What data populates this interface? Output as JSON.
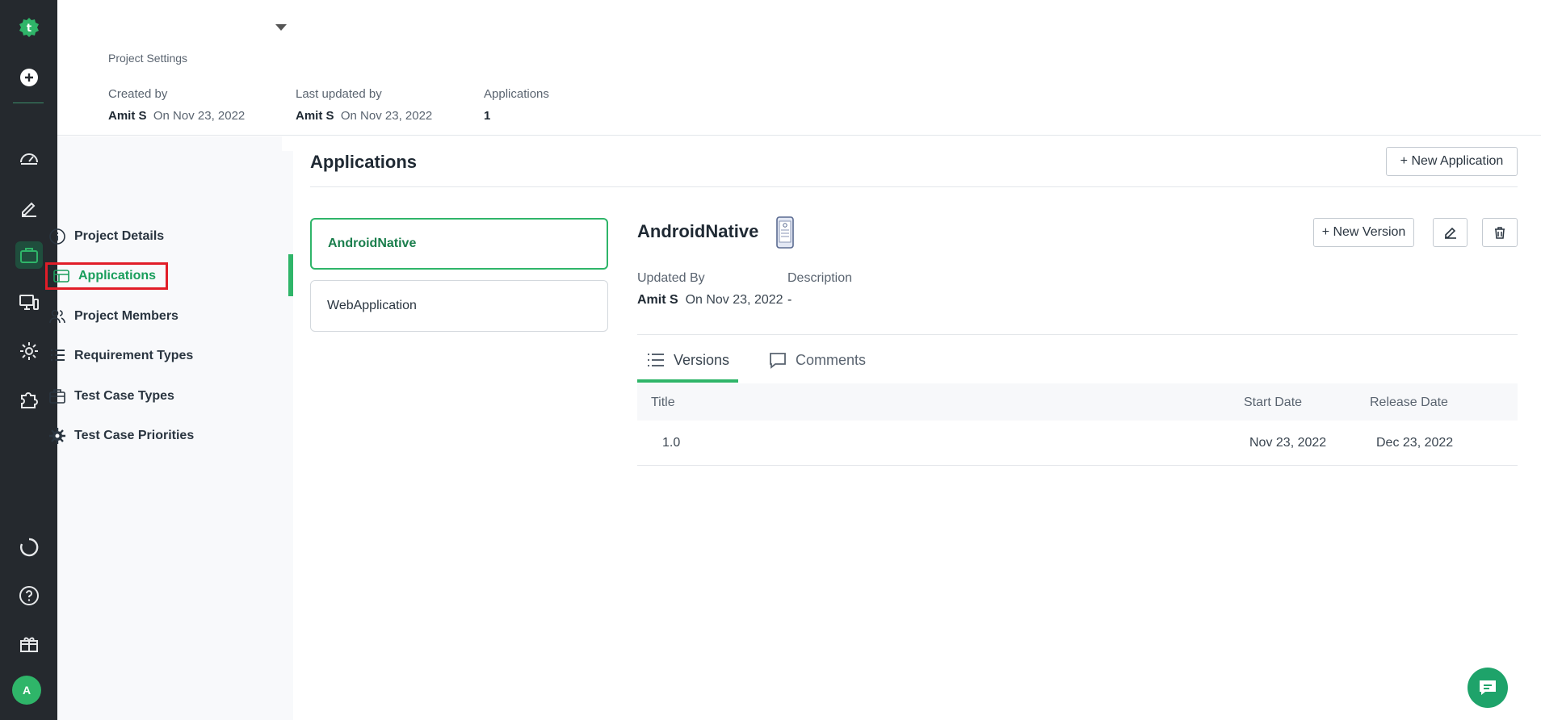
{
  "header": {
    "breadcrumb": "Project Settings",
    "created_by_label": "Created by",
    "created_by_name": "Amit S",
    "created_by_date": "On Nov 23, 2022",
    "updated_by_label": "Last updated by",
    "updated_by_name": "Amit S",
    "updated_by_date": "On Nov 23, 2022",
    "applications_label": "Applications",
    "applications_count": "1"
  },
  "sidebar": {
    "items": [
      {
        "label": "Project Details",
        "icon": "info-icon"
      },
      {
        "label": "Applications",
        "icon": "applications-icon"
      },
      {
        "label": "Project Members",
        "icon": "members-icon"
      },
      {
        "label": "Requirement Types",
        "icon": "list-icon"
      },
      {
        "label": "Test Case Types",
        "icon": "briefcase-icon"
      },
      {
        "label": "Test Case Priorities",
        "icon": "gear-icon"
      }
    ],
    "active": "Applications"
  },
  "main": {
    "title": "Applications",
    "new_application_label": "+ New Application",
    "apps": [
      "AndroidNative",
      "WebApplication"
    ],
    "selected_app": "AndroidNative"
  },
  "detail": {
    "title": "AndroidNative",
    "new_version_label": "+ New Version",
    "updated_by_label": "Updated By",
    "updated_by_name": "Amit S",
    "updated_by_date": "On Nov 23, 2022",
    "description_label": "Description",
    "description_value": "-",
    "tabs": [
      "Versions",
      "Comments"
    ],
    "table": {
      "columns": [
        "Title",
        "Start Date",
        "Release Date"
      ],
      "rows": [
        {
          "title": "1.0",
          "start": "Nov 23, 2022",
          "release": "Dec 23, 2022"
        }
      ]
    }
  },
  "user": {
    "avatar_initial": "A"
  },
  "colors": {
    "accent": "#2fb569",
    "rail": "#25292e",
    "highlight": "#e11d28"
  }
}
